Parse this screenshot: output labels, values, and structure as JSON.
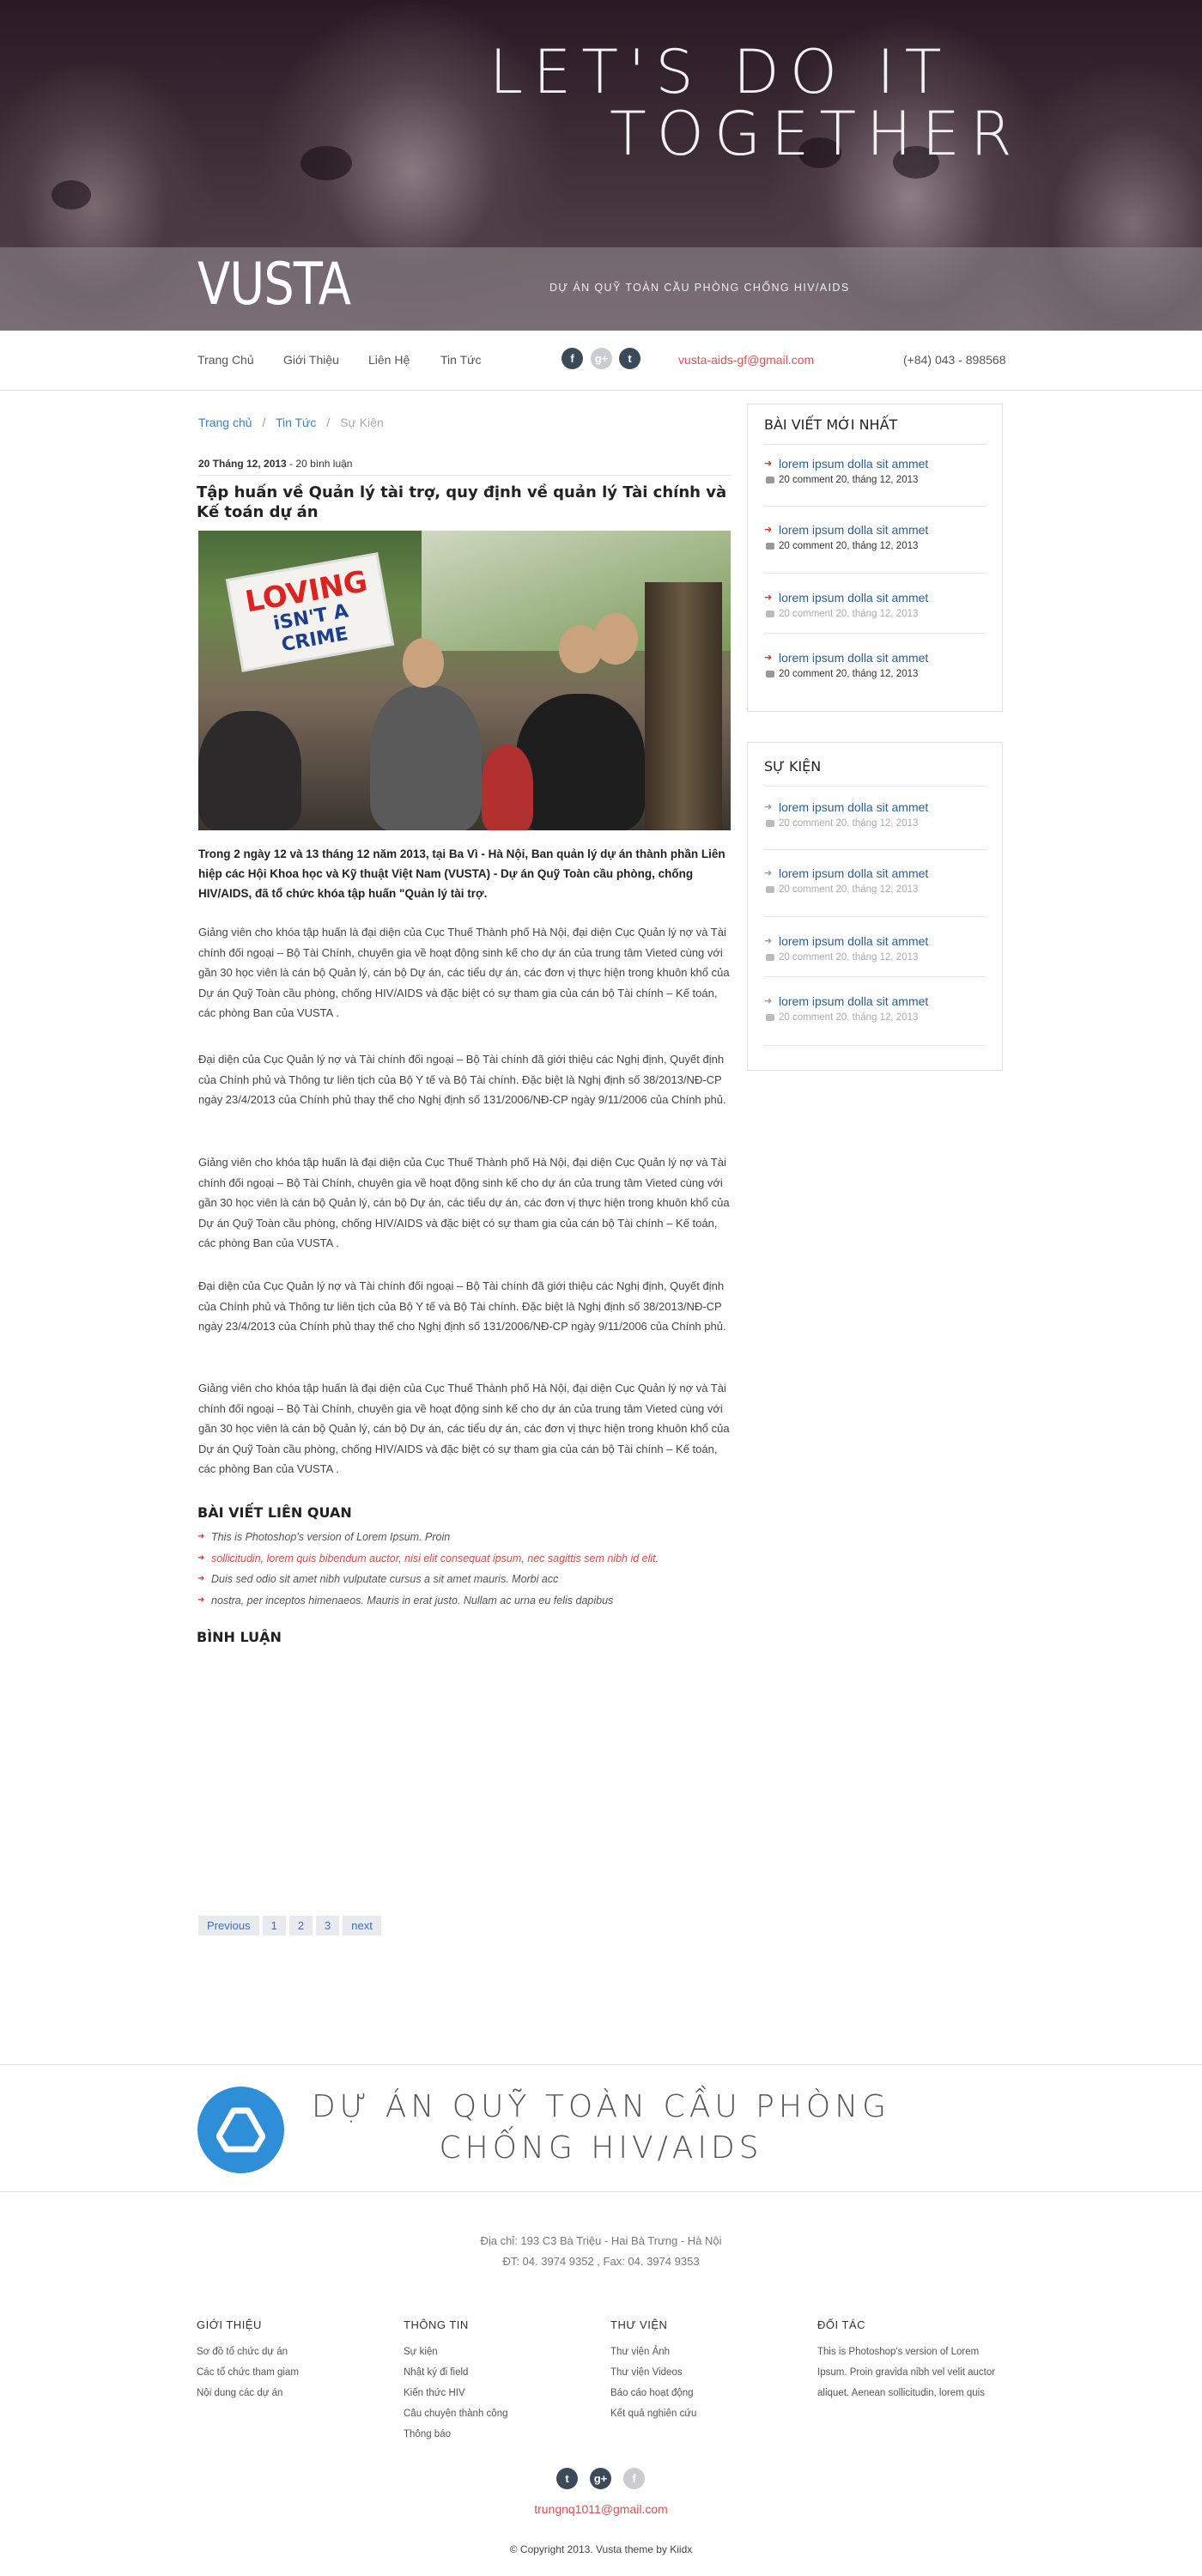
{
  "hero": {
    "title_line1": "LET'S DO IT",
    "title_line2": "TOGETHER",
    "logo": "VUSTA",
    "tagline": "DỰ ÁN QUỸ TOÀN CẦU PHÒNG CHỐNG HIV/AIDS"
  },
  "nav": {
    "items": [
      "Trang Chủ",
      "Giới Thiệu",
      "Liên Hệ",
      "Tin Tức"
    ],
    "social_icons": [
      "facebook-icon",
      "google-plus-icon",
      "twitter-icon"
    ],
    "email": "vusta-aids-gf@gmail.com",
    "phone": "(+84) 043 - 898568"
  },
  "breadcrumb": {
    "home": "Trang chủ",
    "news": "Tin Tức",
    "current": "Sự Kiện",
    "sep": "/"
  },
  "article": {
    "date": "20 Tháng 12, 2013",
    "comments": "- 20 bình luận",
    "title": "Tập huấn về Quản lý tài trợ, quy định về quản lý Tài chính và Kế toán dự án",
    "photo_sign_1": "LOVING",
    "photo_sign_2": "iSN'T A CRIME",
    "lead": "Trong 2 ngày 12 và 13 tháng 12 năm 2013, tại Ba Vì - Hà Nội, Ban quản lý dự án thành phần Liên hiệp các Hội Khoa học và Kỹ thuật Việt Nam (VUSTA) - Dự án Quỹ Toàn cầu phòng, chống HIV/AIDS,  đã tổ chức khóa tập huấn \"Quản lý tài trợ.",
    "p1": "Giảng viên cho khóa tập huấn là đại diện của Cục Thuế Thành phố Hà Nội, đại diện Cục Quản lý nợ và Tài chính đối ngoại – Bộ Tài Chính, chuyên gia về hoạt động sinh kế cho dự án của trung tâm Vieted cùng với gần 30 học viên là cán bộ Quản lý, cán bộ Dự án, các tiểu dự án, các đơn vị thực hiện trong khuôn khổ của Dự án Quỹ Toàn cầu phòng, chống HIV/AIDS và đặc biệt có sự tham gia của cán bộ Tài chính – Kế toán, các phòng Ban của VUSTA .",
    "p2": "Đại diện của Cục Quản lý nợ và Tài chính đối ngoại – Bộ Tài chính đã giới thiệu các Nghị định, Quyết định của Chính phủ và Thông tư liên tịch của Bộ Y tế và Bộ Tài chính. Đặc biệt là Nghị định số 38/2013/NĐ-CP ngày 23/4/2013 của Chính phủ thay thế cho Nghị định số 131/2006/NĐ-CP ngày 9/11/2006 của Chính phủ.",
    "p3": "Giảng viên cho khóa tập huấn là đại diện của Cục Thuế Thành phố Hà Nội, đại diện Cục Quản lý nợ và Tài chính đối ngoại – Bộ Tài Chính, chuyên gia về hoạt động sinh kế cho dự án của trung tâm Vieted cùng với gần 30 học viên là cán bộ Quản lý, cán bộ Dự án, các tiểu dự án, các đơn vị thực hiện trong khuôn khổ của Dự án Quỹ Toàn cầu phòng, chống HIV/AIDS và đặc biệt có sự tham gia của cán bộ Tài chính – Kế toán, các phòng Ban của VUSTA .",
    "p4": "Đại diện của Cục Quản lý nợ và Tài chính đối ngoại – Bộ Tài chính đã giới thiệu các Nghị định, Quyết định của Chính phủ và Thông tư liên tịch của Bộ Y tế và Bộ Tài chính. Đặc biệt là Nghị định số 38/2013/NĐ-CP ngày 23/4/2013 của Chính phủ thay thế cho Nghị định số 131/2006/NĐ-CP ngày 9/11/2006 của Chính phủ.",
    "p5": "Giảng viên cho khóa tập huấn là đại diện của Cục Thuế Thành phố Hà Nội, đại diện Cục Quản lý nợ và Tài chính đối ngoại – Bộ Tài Chính, chuyên gia về hoạt động sinh kế cho dự án của trung tâm Vieted cùng với gần 30 học viên là cán bộ Quản lý, cán bộ Dự án, các tiểu dự án, các đơn vị thực hiện trong khuôn khổ của Dự án Quỹ Toàn cầu phòng, chống HIV/AIDS và đặc biệt có sự tham gia của cán bộ Tài chính – Kế toán, các phòng Ban của VUSTA ."
  },
  "related": {
    "heading": "BÀI VIẾT LIÊN QUAN",
    "items": [
      "This is Photoshop's version  of Lorem Ipsum. Proin",
      "sollicitudin, lorem quis bibendum auctor, nisi elit consequat ipsum, nec sagittis sem nibh id elit.",
      "Duis sed odio sit amet nibh vulputate cursus a sit amet mauris. Morbi acc",
      "nostra, per inceptos himenaeos. Mauris in erat justo. Nullam ac urna eu felis dapibus"
    ]
  },
  "comments_heading": "BÌNH LUẬN",
  "pager": [
    "Previous",
    "1",
    "2",
    "3",
    "next"
  ],
  "sidebar": {
    "latest": {
      "heading": "BÀI VIẾT MỚI NHẤT",
      "posts": [
        {
          "title": "lorem ipsum dolla sit ammet",
          "meta": "20 comment  20, tháng 12, 2013"
        },
        {
          "title": "lorem ipsum dolla sit ammet",
          "meta": "20 comment  20, tháng 12, 2013"
        },
        {
          "title": "lorem ipsum dolla sit ammet",
          "meta": "20 comment  20, tháng 12, 2013"
        },
        {
          "title": "lorem ipsum dolla sit ammet",
          "meta": "20 comment  20, tháng 12, 2013"
        }
      ]
    },
    "events": {
      "heading": "SỰ KIỆN",
      "posts": [
        {
          "title": "lorem ipsum dolla sit ammet",
          "meta": "20 comment  20, tháng 12, 2013"
        },
        {
          "title": "lorem ipsum dolla sit ammet",
          "meta": "20 comment  20, tháng 12, 2013"
        },
        {
          "title": "lorem ipsum dolla sit ammet",
          "meta": "20 comment  20, tháng 12, 2013"
        },
        {
          "title": "lorem ipsum dolla sit ammet",
          "meta": "20 comment  20, tháng 12, 2013"
        }
      ]
    }
  },
  "footer": {
    "title_line1": "DỰ ÁN QUỸ TOÀN CẦU PHÒNG",
    "title_line2": "CHỐNG HIV/AIDS",
    "address": "Địa chỉ: 193 C3 Bà Triệu - Hai Bà Trưng - Hà Nội",
    "phone": "ĐT: 04. 3974 9352 , Fax: 04. 3974 9353",
    "cols": {
      "about": {
        "heading": "GIỚI THIỆU",
        "links": [
          "Sơ đồ tổ chức dự án",
          "Các tổ chức tham giam",
          "Nội dung các dự án"
        ]
      },
      "news": {
        "heading": "THÔNG TIN",
        "links": [
          "Sự kiện",
          "Nhật ký đi field",
          "Kiến thức HIV",
          "Câu chuyện thành công",
          "Thông báo"
        ]
      },
      "library": {
        "heading": "THƯ VIỆN",
        "links": [
          "Thư viện Ảnh",
          "Thư viện Videos",
          "Báo cáo hoạt động",
          "Kết quả nghiên cứu"
        ]
      },
      "partners": {
        "heading": "ĐỐI TÁC",
        "text": "This is Photoshop's version  of Lorem Ipsum. Proin gravida nibh vel velit auctor aliquet. Aenean sollicitudin, lorem quis"
      }
    },
    "email": "trungnq1011@gmail.com",
    "copyright": "© Copyright 2013. Vusta theme by Kiidx"
  },
  "colors": {
    "accent_red": "#e05050",
    "link_blue": "#2a5e90",
    "logo_blue": "#2e8fd8"
  }
}
